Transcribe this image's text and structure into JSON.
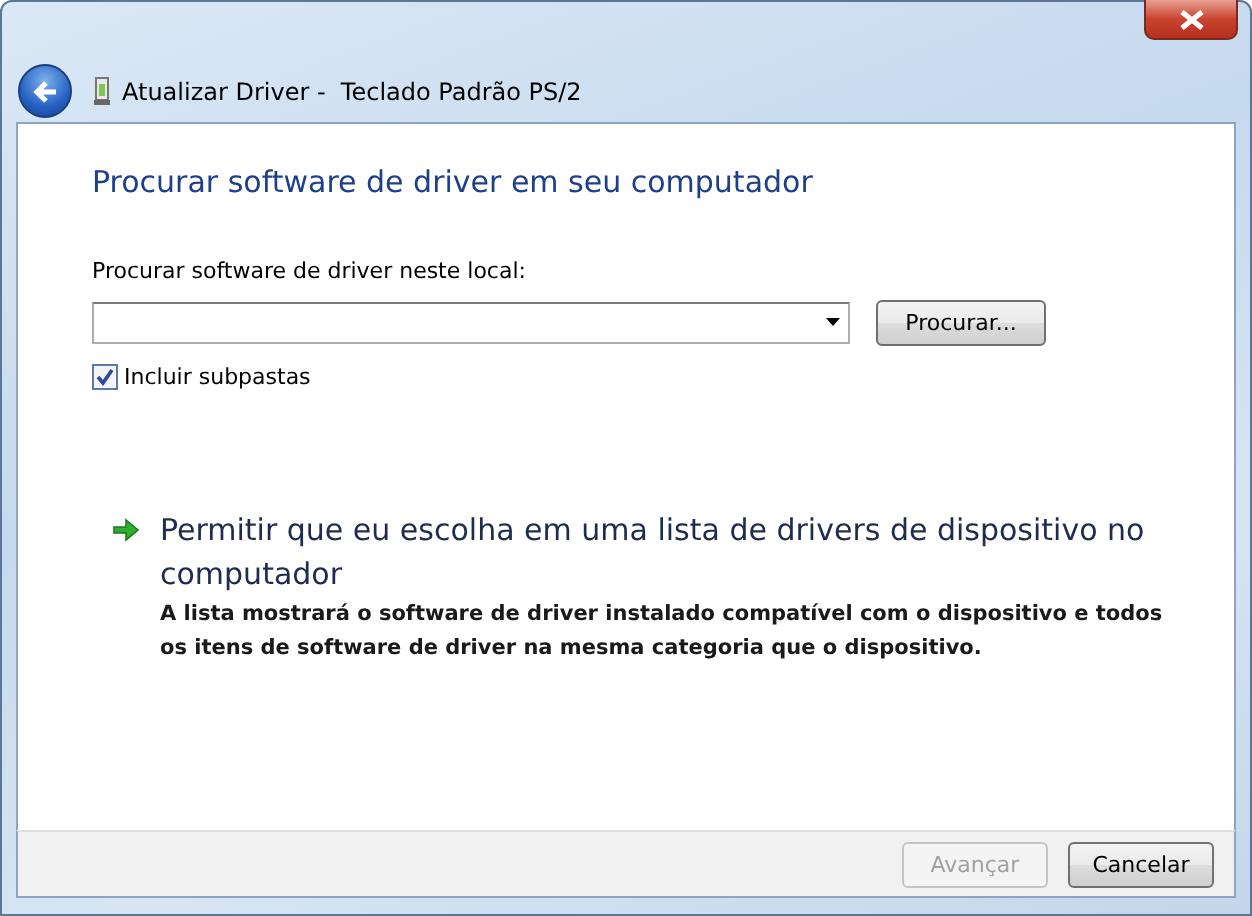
{
  "window": {
    "title": "Atualizar Driver -  Teclado Padrão PS/2"
  },
  "heading": "Procurar software de driver em seu computador",
  "location": {
    "label": "Procurar software de driver neste local:",
    "browse_button": "Procurar..."
  },
  "include_subfolders": {
    "label": "Incluir subpastas",
    "checked": true
  },
  "option": {
    "title": "Permitir que eu escolha em uma lista de drivers de dispositivo no computador",
    "description": "A lista mostrará o software de driver instalado compatível com o dispositivo e todos os itens de software de driver na mesma categoria que o dispositivo."
  },
  "buttons": [
    {
      "label": "Avançar",
      "disabled": true
    },
    {
      "label": "Cancelar",
      "disabled": false
    }
  ]
}
